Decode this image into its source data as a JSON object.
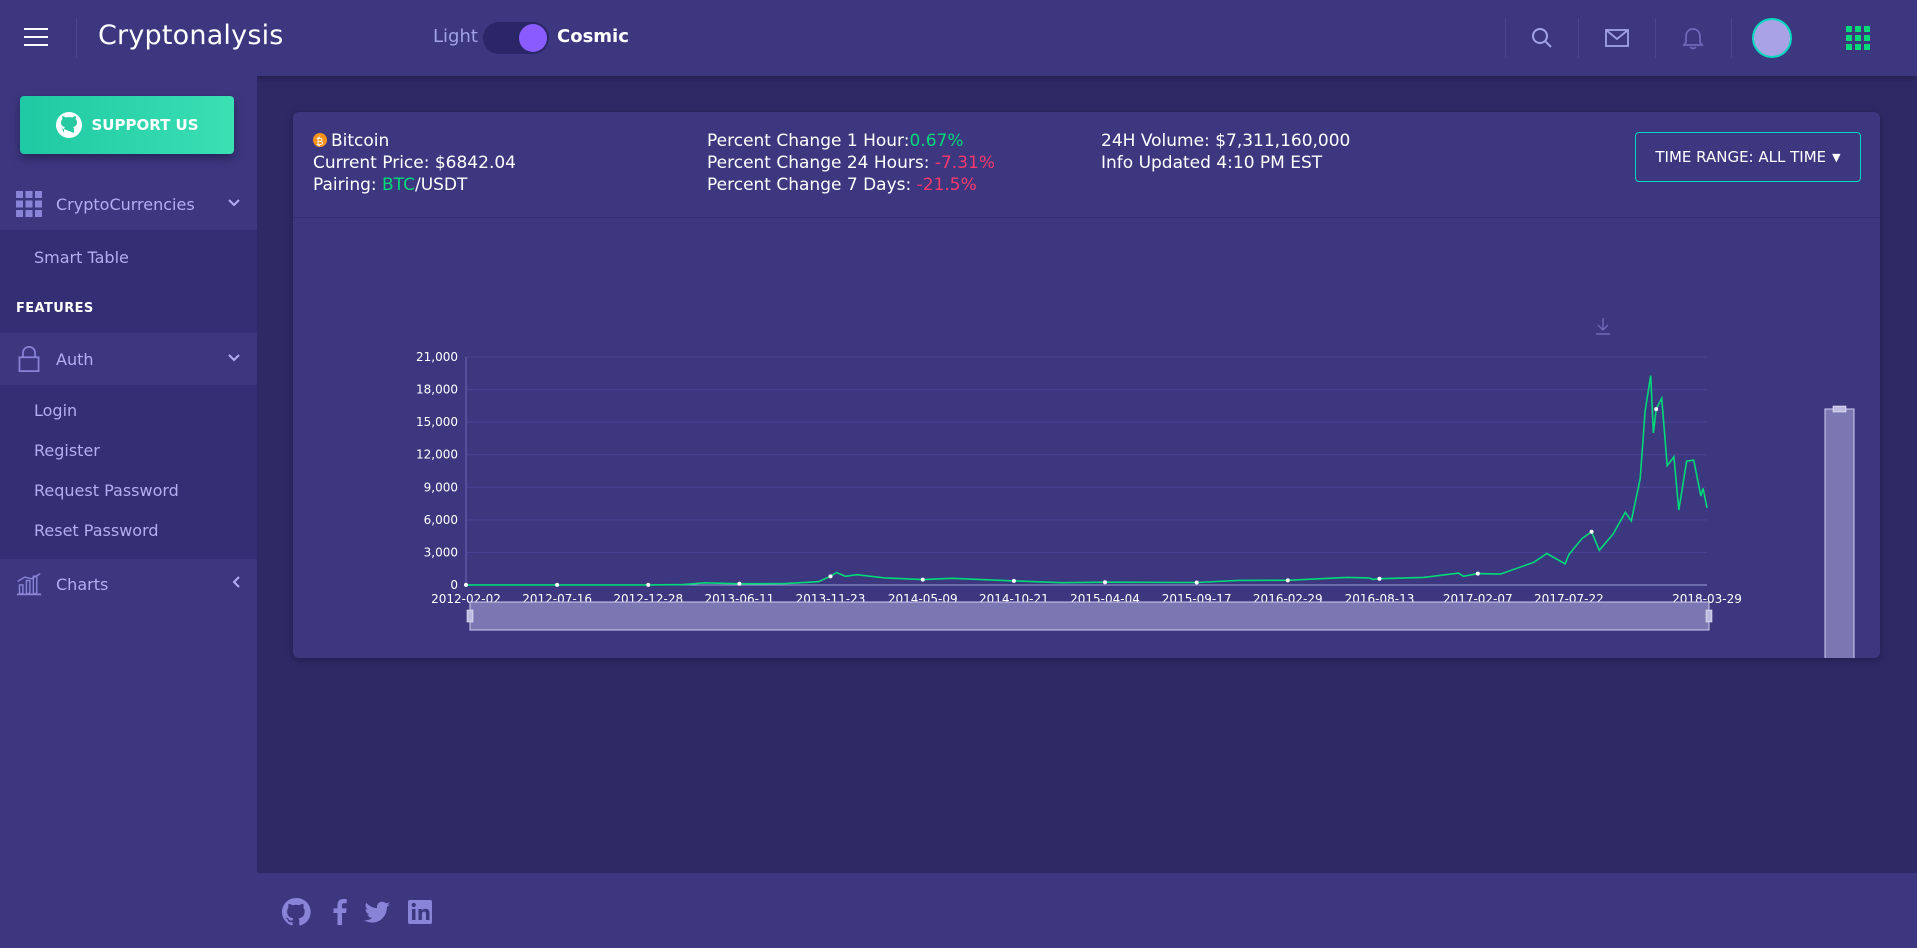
{
  "header": {
    "brand": "Cryptonalysis",
    "theme_light_label": "Light",
    "theme_cosmic_label": "Cosmic",
    "theme_selected": "Cosmic"
  },
  "sidebar": {
    "support_label": "SUPPORT US",
    "crypto_label": "CryptoCurrencies",
    "smart_table_label": "Smart Table",
    "features_label": "FEATURES",
    "auth_label": "Auth",
    "auth_items": [
      "Login",
      "Register",
      "Request Password",
      "Reset Password"
    ],
    "charts_label": "Charts"
  },
  "info": {
    "coin": "Bitcoin",
    "price_label": "Current Price: ",
    "price_value": "$6842.04",
    "pairing_label": "Pairing: ",
    "pairing_base": "BTC",
    "pairing_quote": "/USDT",
    "pc1h_label": "Percent Change 1 Hour:",
    "pc1h_value": "0.67%",
    "pc24h_label": "Percent Change 24 Hours: ",
    "pc24h_value": "-7.31%",
    "pc7d_label": "Percent Change 7 Days: ",
    "pc7d_value": "-21.5%",
    "volume_label": "24H Volume: ",
    "volume_value": "$7,311,160,000",
    "updated": "Info Updated 4:10 PM EST"
  },
  "range_button": {
    "label": "TIME RANGE: ALL TIME"
  },
  "colors": {
    "accent": "#00d9bf",
    "line": "#00d977",
    "negative": "#ff386a",
    "background": "#2f2966",
    "panel": "#3d3780"
  },
  "icons": {
    "header": [
      "search-icon",
      "mail-icon",
      "bell-icon",
      "grid-icon"
    ],
    "footer": [
      "github-icon",
      "facebook-icon",
      "twitter-icon",
      "linkedin-icon"
    ]
  },
  "chart_data": {
    "type": "line",
    "title": "",
    "xlabel": "",
    "ylabel": "",
    "ylim": [
      0,
      21000
    ],
    "yticks": [
      0,
      3000,
      6000,
      9000,
      12000,
      15000,
      18000,
      21000
    ],
    "ytick_labels": [
      "0",
      "3,000",
      "6,000",
      "9,000",
      "12,000",
      "15,000",
      "18,000",
      "21,000"
    ],
    "xlim": [
      "2012-02-02",
      "2018-03-29"
    ],
    "xtick_labels": [
      "2012-02-02",
      "2012-07-16",
      "2012-12-28",
      "2013-06-11",
      "2013-11-23",
      "2014-05-09",
      "2014-10-21",
      "2015-04-04",
      "2015-09-17",
      "2016-02-29",
      "2016-08-13",
      "2017-02-07",
      "2017-07-22",
      "2018-03-29"
    ],
    "grid": true,
    "series": [
      {
        "values": [
          [
            "2012-02-02",
            6
          ],
          [
            "2012-07-16",
            9
          ],
          [
            "2012-12-28",
            13
          ],
          [
            "2013-03-01",
            40
          ],
          [
            "2013-04-10",
            200
          ],
          [
            "2013-06-11",
            110
          ],
          [
            "2013-09-01",
            130
          ],
          [
            "2013-11-01",
            300
          ],
          [
            "2013-11-23",
            800
          ],
          [
            "2013-12-04",
            1150
          ],
          [
            "2013-12-20",
            800
          ],
          [
            "2014-01-10",
            950
          ],
          [
            "2014-03-01",
            650
          ],
          [
            "2014-05-09",
            500
          ],
          [
            "2014-07-01",
            620
          ],
          [
            "2014-10-21",
            380
          ],
          [
            "2015-01-15",
            210
          ],
          [
            "2015-04-04",
            255
          ],
          [
            "2015-09-17",
            230
          ],
          [
            "2015-12-01",
            420
          ],
          [
            "2016-02-29",
            430
          ],
          [
            "2016-06-15",
            700
          ],
          [
            "2016-07-25",
            650
          ],
          [
            "2016-08-01",
            520
          ],
          [
            "2016-08-13",
            580
          ],
          [
            "2016-11-01",
            700
          ],
          [
            "2017-01-03",
            1100
          ],
          [
            "2017-01-12",
            800
          ],
          [
            "2017-02-07",
            1050
          ],
          [
            "2017-03-20",
            1000
          ],
          [
            "2017-05-20",
            2100
          ],
          [
            "2017-06-12",
            2900
          ],
          [
            "2017-07-15",
            1950
          ],
          [
            "2017-07-22",
            2800
          ],
          [
            "2017-08-15",
            4300
          ],
          [
            "2017-09-01",
            4900
          ],
          [
            "2017-09-15",
            3200
          ],
          [
            "2017-10-10",
            4700
          ],
          [
            "2017-11-01",
            6700
          ],
          [
            "2017-11-12",
            5900
          ],
          [
            "2017-11-28",
            9800
          ],
          [
            "2017-12-07",
            16000
          ],
          [
            "2017-12-17",
            19300
          ],
          [
            "2017-12-22",
            14000
          ],
          [
            "2017-12-27",
            16200
          ],
          [
            "2018-01-06",
            17200
          ],
          [
            "2018-01-16",
            11000
          ],
          [
            "2018-01-28",
            11800
          ],
          [
            "2018-02-06",
            6900
          ],
          [
            "2018-02-20",
            11400
          ],
          [
            "2018-03-05",
            11500
          ],
          [
            "2018-03-18",
            8200
          ],
          [
            "2018-03-22",
            8900
          ],
          [
            "2018-03-29",
            7100
          ]
        ]
      }
    ],
    "markers": [
      "2012-02-02",
      "2012-07-16",
      "2012-12-28",
      "2013-06-11",
      "2013-11-23",
      "2014-05-09",
      "2014-10-21",
      "2015-04-04",
      "2015-09-17",
      "2016-02-29",
      "2016-08-13",
      "2017-02-07",
      "2017-09-01",
      "2017-12-27"
    ]
  }
}
